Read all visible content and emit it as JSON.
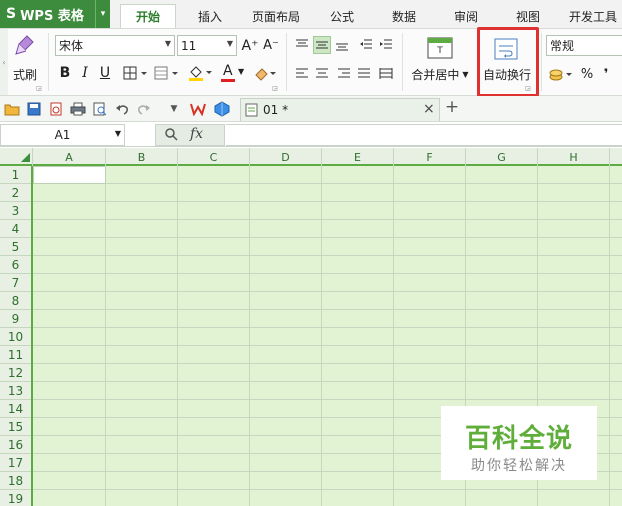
{
  "app": {
    "logo_mark": "S",
    "logo_text": "WPS 表格",
    "logo_dropdown": "▾",
    "accent": "#3d8b3d"
  },
  "tabs": [
    {
      "label": "开始",
      "active": true
    },
    {
      "label": "插入",
      "active": false
    },
    {
      "label": "页面布局",
      "active": false
    },
    {
      "label": "公式",
      "active": false
    },
    {
      "label": "数据",
      "active": false
    },
    {
      "label": "审阅",
      "active": false
    },
    {
      "label": "视图",
      "active": false
    },
    {
      "label": "开发工具",
      "active": false
    }
  ],
  "ribbon": {
    "format_painter_label": "式刷",
    "font_name": "宋体",
    "font_size": "11",
    "grow_font": "A⁺",
    "shrink_font": "A⁻",
    "bold": "B",
    "italic": "I",
    "underline": "U",
    "font_color_letter": "A",
    "merge_center_label": "合并居中",
    "wrap_text_label": "自动换行",
    "number_format": "常规",
    "percent": "%",
    "comma": "❜"
  },
  "quickbar": {
    "doc_tab_label": "01 *",
    "close": "×",
    "new_tab": "+"
  },
  "formula_bar": {
    "name_box": "A1",
    "fx_label": "fx"
  },
  "sheet": {
    "columns": [
      "A",
      "B",
      "C",
      "D",
      "E",
      "F",
      "G",
      "H"
    ],
    "rows": [
      "1",
      "2",
      "3",
      "4",
      "5",
      "6",
      "7",
      "8",
      "9",
      "10",
      "11",
      "12",
      "13",
      "14",
      "15",
      "16",
      "17",
      "18",
      "19"
    ],
    "active_cell": "A1"
  },
  "watermark": {
    "title": "百科全说",
    "subtitle": "助你轻松解决"
  }
}
